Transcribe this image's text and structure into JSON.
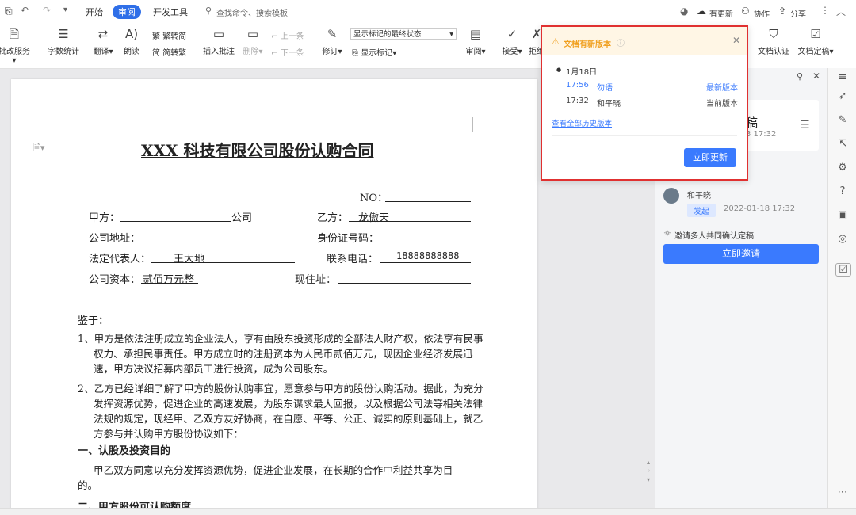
{
  "menubar": {
    "tabs": [
      "开始",
      "审阅",
      "开发工具"
    ],
    "active_tab": "审阅",
    "search_placeholder": "查找命令、搜索模板",
    "right": {
      "update": "有更新",
      "collab": "协作",
      "share": "分享"
    }
  },
  "ribbon": {
    "modify_service": "批改服务",
    "word_count": "字数统计",
    "translate": "翻译",
    "read_aloud": "朗读",
    "trad_to_simp": "繁转简",
    "simp_to_trad": "简转繁",
    "insert_comment": "插入批注",
    "delete": "删除",
    "prev": "上一条",
    "next": "下一条",
    "revise": "修订",
    "markup_state": "显示标记的最终状态",
    "show_markup": "显示标记",
    "review": "审阅",
    "accept": "接受",
    "reject": "拒绝",
    "doc_cert": "文档认证",
    "doc_final": "文档定稿"
  },
  "popup": {
    "title": "文档有新版本",
    "date": "1月18日",
    "versions": [
      {
        "time": "17:56",
        "user": "勿语",
        "tag": "最新版本"
      },
      {
        "time": "17:32",
        "user": "和平晓",
        "tag": "当前版本"
      }
    ],
    "history_link": "查看全部历史版本",
    "update_button": "立即更新"
  },
  "rpane": {
    "card_title_partial": "稿",
    "card_time_partial": "3 17:32",
    "user": "和平晓",
    "status_badge": "发起",
    "timestamp": "2022-01-18 17:32",
    "invite_text": "邀请多人共同确认定稿",
    "invite_button": "立即邀请"
  },
  "document": {
    "title": "XXX 科技有限公司股份认购合同",
    "no_label": "NO：",
    "party_a": "甲方：",
    "company_suffix": "公司",
    "party_b": "乙方：",
    "party_b_name": "龙傲天",
    "company_addr": "公司地址：",
    "id_no": "身份证号码：",
    "legal_rep": "法定代表人：",
    "legal_rep_name": "王大地",
    "phone_label": "联系电话：",
    "phone": "18888888888",
    "capital_label": "公司资本：",
    "capital": "贰佰万元整",
    "residence": "现住址：",
    "whereas": "鉴于：",
    "p1": "1、甲方是依法注册成立的企业法人，享有由股东投资形成的全部法人财产权，依法享有民事权力、承担民事责任。甲方成立时的注册资本为人民币贰佰万元，现因企业经济发展迅速，甲方决议招募内部员工进行投资，成为公司股东。",
    "p2": "2、乙方已经详细了解了甲方的股份认购事宜，愿意参与甲方的股份认购活动。据此，为充分发挥资源优势，促进企业的高速发展，为股东谋求最大回报，以及根据公司法等相关法律法规的规定，现经甲、乙双方友好协商，在自愿、平等、公正、诚实的原则基础上，就乙方参与并认购甲方股份协议如下：",
    "h1": "一、认股及投资目的",
    "p3": "甲乙双方同意以充分发挥资源优势，促进企业发展，在长期的合作中利益共享为目的。",
    "h2": "二、甲方股份可认购额度"
  }
}
